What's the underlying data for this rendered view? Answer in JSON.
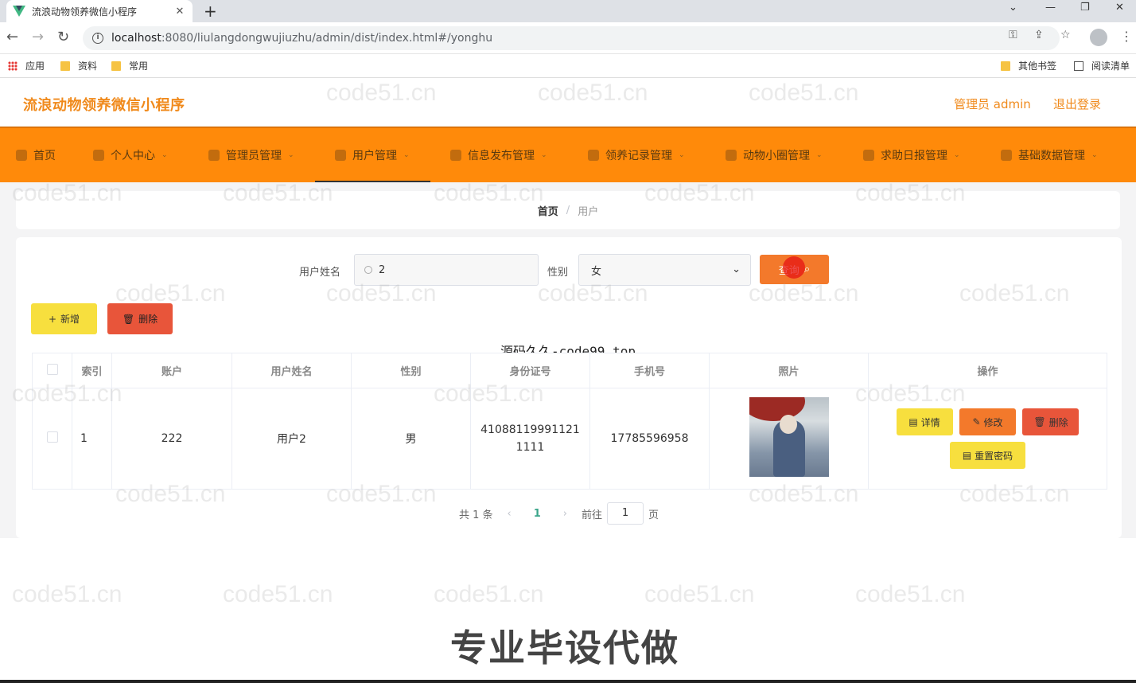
{
  "browser": {
    "tab_title": "流浪动物领养微信小程序",
    "url_host": "localhost",
    "url_rest": ":8080/liulangdongwujiuzhu/admin/dist/index.html#/yonghu",
    "bookmarks": [
      "应用",
      "资料",
      "常用"
    ],
    "bookmarks_right": [
      "其他书签",
      "阅读清单"
    ]
  },
  "header": {
    "title": "流浪动物领养微信小程序",
    "admin_label": "管理员 admin",
    "logout_label": "退出登录"
  },
  "nav": {
    "items": [
      {
        "label": "首页",
        "icon": "home-icon"
      },
      {
        "label": "个人中心",
        "icon": "person-icon"
      },
      {
        "label": "管理员管理",
        "icon": "admin-icon"
      },
      {
        "label": "用户管理",
        "icon": "user-icon"
      },
      {
        "label": "信息发布管理",
        "icon": "info-icon"
      },
      {
        "label": "领养记录管理",
        "icon": "record-icon"
      },
      {
        "label": "动物小圈管理",
        "icon": "circle-icon"
      },
      {
        "label": "求助日报管理",
        "icon": "help-icon"
      },
      {
        "label": "基础数据管理",
        "icon": "data-icon"
      }
    ],
    "active": "用户管理"
  },
  "breadcrumb": {
    "home": "首页",
    "separator": "/",
    "current": "用户"
  },
  "search": {
    "name_label": "用户姓名",
    "name_value": "2",
    "gender_label": "性别",
    "gender_value": "女",
    "query_label": "查询"
  },
  "toolbar": {
    "add_label": "新增",
    "delete_label": "删除"
  },
  "overlay_text": "源码久久-code99.top",
  "table": {
    "headers": [
      "索引",
      "账户",
      "用户姓名",
      "性别",
      "身份证号",
      "手机号",
      "照片",
      "操作"
    ],
    "rows": [
      {
        "index": "1",
        "account": "222",
        "name": "用户2",
        "gender": "男",
        "id_number": "410881199911211111",
        "phone": "17785596958"
      }
    ],
    "actions": {
      "detail": "详情",
      "edit": "修改",
      "delete": "删除",
      "reset": "重置密码"
    }
  },
  "pagination": {
    "total": "共 1 条",
    "current_page": "1",
    "goto_label": "前往",
    "goto_value": "1",
    "page_suffix": "页"
  },
  "caption": "专业毕设代做",
  "watermark": "code51.cn",
  "colors": {
    "brand": "#f08a1c",
    "nav_bg": "#ff8a0a",
    "query": "#f3792b",
    "add": "#f7df3e",
    "delete": "#e8553a"
  }
}
